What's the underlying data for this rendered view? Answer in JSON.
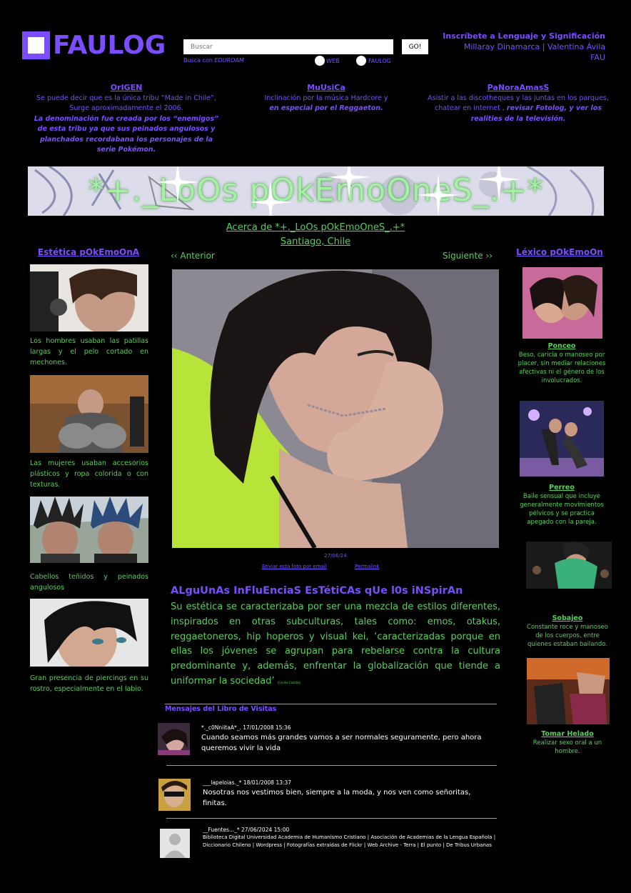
{
  "header": {
    "logo": "FAULOG",
    "search_placeholder": "Buscar",
    "go_label": "GO!",
    "search_with_prefix": "Busca con",
    "search_with_name": "EDUROAM",
    "radio_web": "WEB",
    "radio_faulog": "FAULOG",
    "signup_title": "Inscríbete a Lenguaje y Significación",
    "signup_names": "Millaray Dinamarca | Valentina Ávila",
    "signup_school": "FAU"
  },
  "intro": {
    "origen": {
      "title": "OrIGEN",
      "text": "Se puede decir que es la única tribu “Made in Chile”, Surge aproximadamente el 2006.",
      "bold": "La denominación fue creada por los “enemigos” de esta tribu ya que sus peinados angulosos y planchados recordabana los personajes de la serie Pokémon."
    },
    "musica": {
      "title": "MuUsiCa",
      "text": "Inclinación por la música Hardcore y",
      "bold": "en especial por el Reggaeton."
    },
    "panoramas": {
      "title": "PaNoraAmasS",
      "text": "Asistir a las discotheques y las juntas en los parques, chatear en internet ,",
      "bold": "revisar Fotolog, y ver los realities de la televisión."
    }
  },
  "banner": {
    "title": "*+._LoOs pOkEmoOneS_.+*"
  },
  "about": {
    "link": "Acerca de *+._LoOs pOkEmoOneS_.+*",
    "location": "Santiago, Chile"
  },
  "left": {
    "title": "Estética pOkEmoOnA",
    "items": [
      {
        "caption": "Los hombres usaban las patillas largas y el pelo cortado en mechones."
      },
      {
        "caption": "Las mujeres usaban accesorios plásticos y ropa colorida o con texturas."
      },
      {
        "caption": "Cabellos teñidos y peinados angulosos"
      },
      {
        "caption": "Gran presencia de piercings en su rostro, especialmente en el labio."
      }
    ]
  },
  "nav": {
    "prev": "‹‹ Anterior",
    "next": "Siguiente ››"
  },
  "photo": {
    "date": "27/06/24",
    "send": "Enviar esta foto por email",
    "permalink": "Permalink"
  },
  "influences": {
    "title": "ALguUnAs InFluEnciaS EsTétiCAs qUe l0s iNSpirAn",
    "text": "Su estética se caracterizaba por ser una mezcla de estilos diferentes, inspirados en otras subculturas, tales como: emos, otakus, reggaetoneros, hip hoperos y  visual kei, ‘caracterizadas porque en ellas los jóvenes se agrupan para rebelarse contra la cultura predominante y, además, enfrentar la globalización que tiende a uniformar la sociedad’",
    "cite": "(Cecilia Castillo)"
  },
  "guestbook": {
    "title": "Mensajes del Libro de Visitas",
    "entries": [
      {
        "meta": "*._c0NniitaA*_. 17/01/2008 15:36",
        "text": "Cuando seamos más grandes vamos a ser normales seguramente, pero ahora queremos vivir la vida"
      },
      {
        "meta": "___lapeloias._* 18/01/2008 13:37",
        "text": "Nosotras nos vestimos bien, siempre a la moda, y nos ven como señoritas, finitas."
      },
      {
        "meta": "__Fuentes..._* 27/06/2024 15:00",
        "text": "Biblioteca Digital Universidad Academia de Humanismo Cristiano | Asociación de Academias de la Lengua Española | Diccionario Chileno | Wordpress | Fotografías extraídas de Flickr | Web Archive - Terra | El punto | De Tribus Urbanas"
      }
    ]
  },
  "right": {
    "title": "Léxico pOkEmoOn",
    "items": [
      {
        "term": "Ponceo",
        "def": "Beso, caricia o manoseo por placer, sin mediar relaciones afectivas ni el género de los involucrados."
      },
      {
        "term": "Perreo",
        "def": "Baile sensual que incluye generalmente movimientos pélvicos y se practica apegado con la pareja."
      },
      {
        "term": "Sobajeo",
        "def": "Constante roce y manoseo de los cuerpos, entre quienes estaban bailando."
      },
      {
        "term": "Tomar Helado",
        "def": "Realizar sexo oral a un hombre."
      }
    ]
  },
  "colors": {
    "accent_purple": "#7b4dff",
    "text_green": "#57d057",
    "background": "#000000"
  }
}
